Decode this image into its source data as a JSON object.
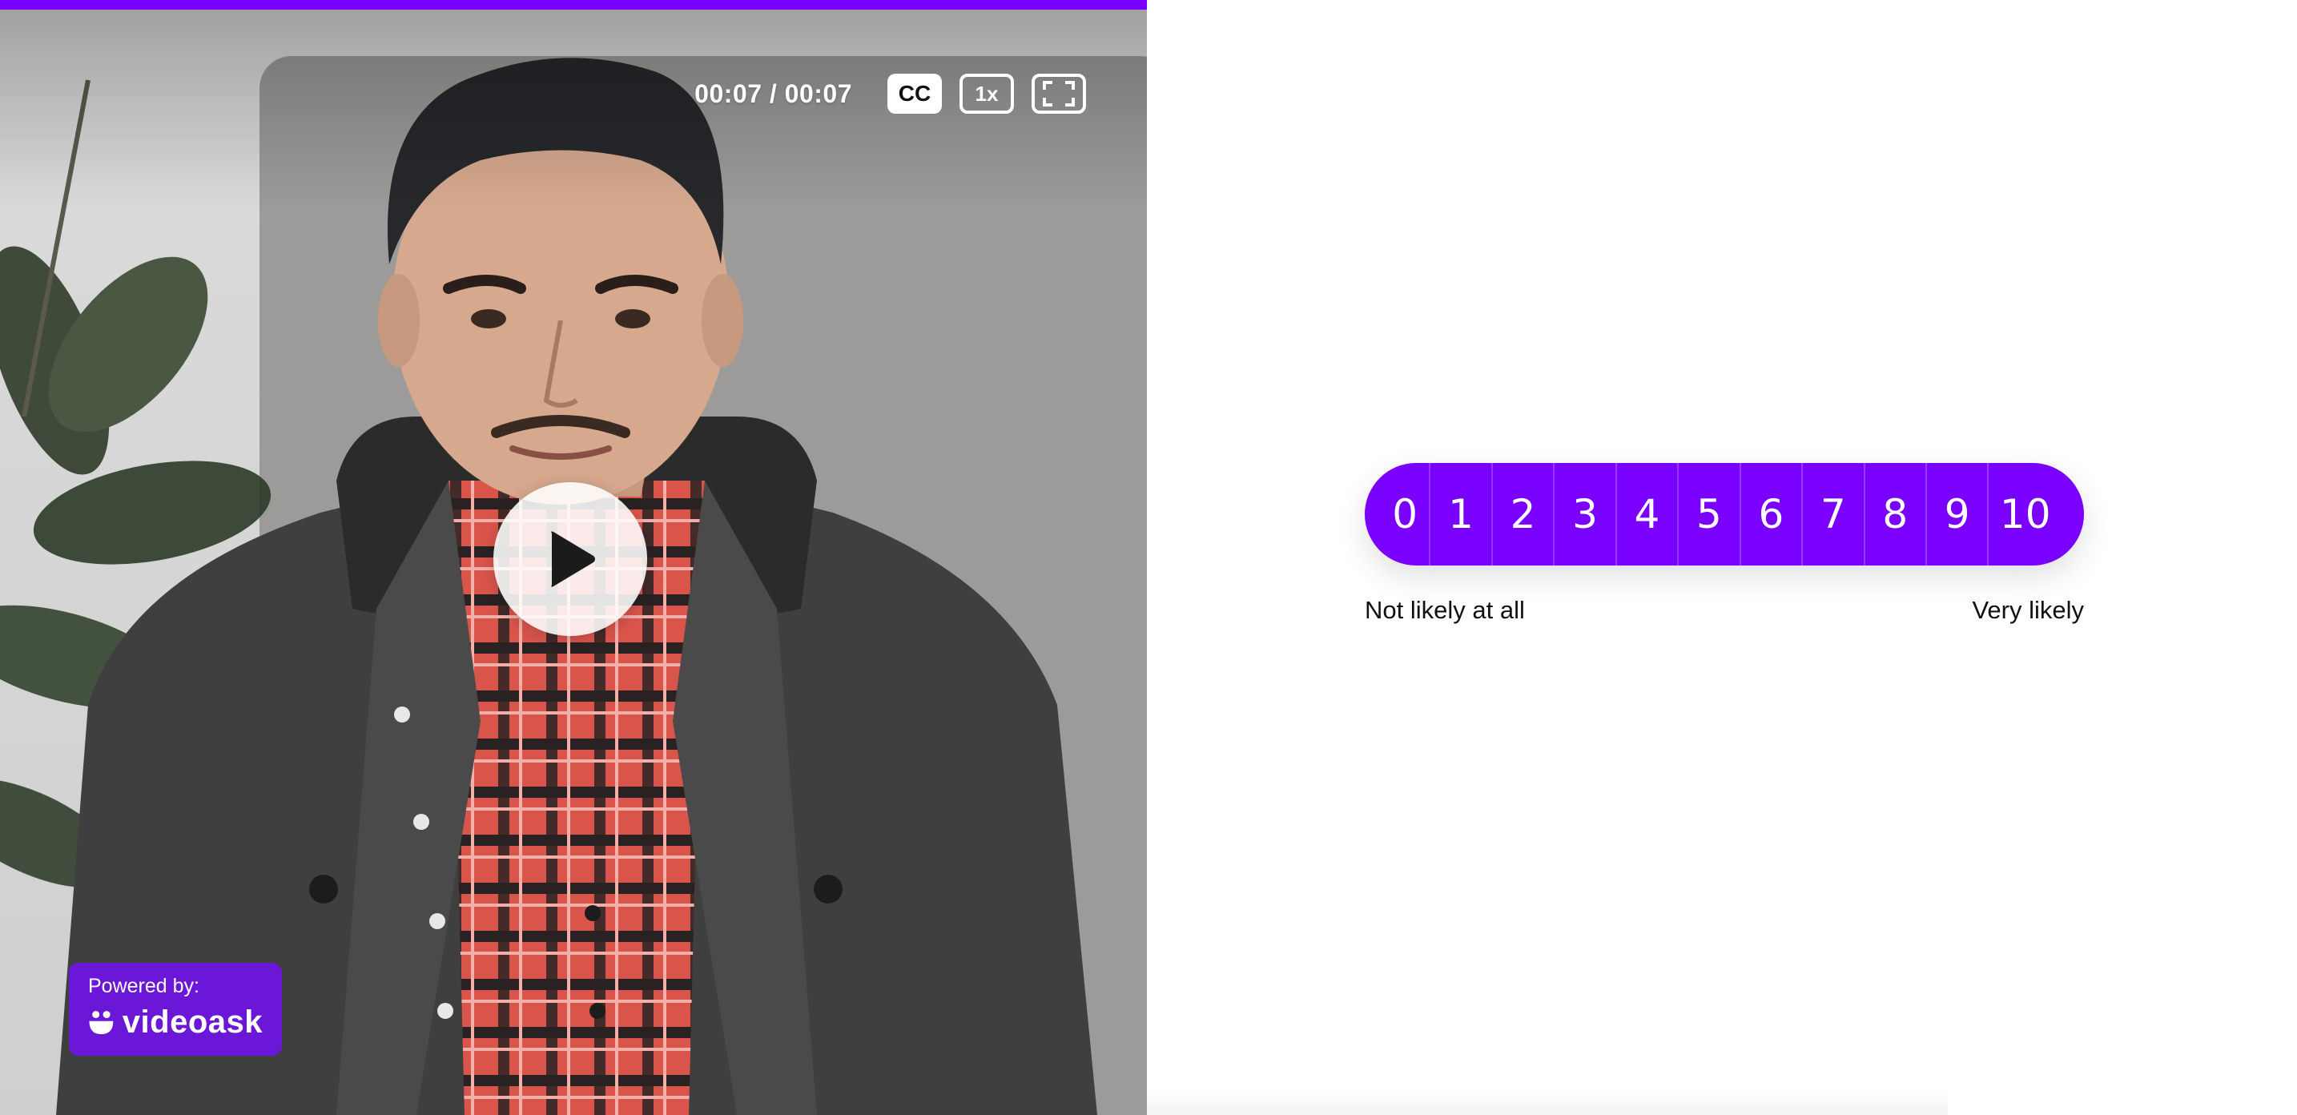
{
  "video": {
    "progress_percent": 100,
    "time_display": "00:07 / 00:07",
    "cc_label": "CC",
    "speed_label": "1x",
    "icons": {
      "play": "play-icon",
      "fullscreen": "fullscreen-icon",
      "brand": "videoask-smile-icon"
    },
    "badge": {
      "powered_by": "Powered by:",
      "brand": "videoask"
    }
  },
  "nps": {
    "options": [
      "0",
      "1",
      "2",
      "3",
      "4",
      "5",
      "6",
      "7",
      "8",
      "9",
      "10"
    ],
    "low_label": "Not likely at all",
    "high_label": "Very likely"
  },
  "colors": {
    "accent": "#7a00ff",
    "badge": "#6b17d8",
    "background": "#ffffff"
  }
}
